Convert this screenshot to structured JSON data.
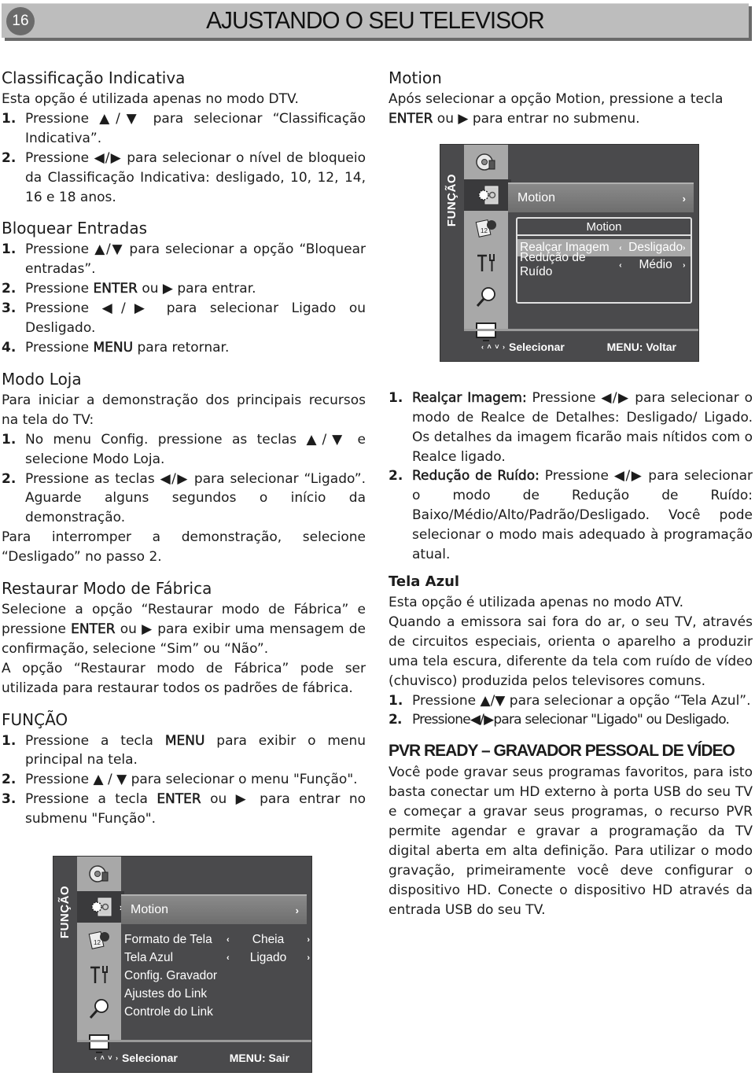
{
  "header": {
    "page_number": "16",
    "title": "AJUSTANDO O SEU TELEVISOR"
  },
  "left": {
    "classificacao": {
      "title": "Classificação Indicativa",
      "intro": "Esta opção é utilizada apenas no modo DTV.",
      "steps": [
        {
          "n": "1.",
          "text": "Pressione ▲/▼ para selecionar “Classificação Indicativa”."
        },
        {
          "n": "2.",
          "text": "Pressione ◀/▶ para selecionar o nível de bloqueio da Classificação Indicativa: desligado, 10, 12, 14, 16 e 18 anos."
        }
      ]
    },
    "bloquear": {
      "title": "Bloquear Entradas",
      "steps": [
        {
          "n": "1.",
          "text": "Pressione ▲/▼ para selecionar a opção “Bloquear entradas”."
        },
        {
          "n": "2.",
          "pre": "Pressione ",
          "bold": "ENTER",
          "post": " ou ▶ para entrar."
        },
        {
          "n": "3.",
          "text": "Pressione ◀/▶ para selecionar Ligado ou Desligado."
        },
        {
          "n": "4.",
          "pre": "Pressione ",
          "bold": "MENU",
          "post": " para retornar."
        }
      ]
    },
    "modo_loja": {
      "title": "Modo Loja",
      "intro": "Para iniciar a demonstração dos principais recursos na tela do TV:",
      "steps": [
        {
          "n": "1.",
          "text": "No menu Config. pressione as teclas ▲/▼ e selecione Modo Loja."
        },
        {
          "n": "2.",
          "text": "Pressione as teclas ◀/▶ para selecionar “Ligado”. Aguarde alguns segundos o início da demonstração."
        }
      ],
      "outro": "Para interromper a demonstração, selecione “Desligado” no passo 2."
    },
    "restaurar": {
      "title": "Restaurar Modo de Fábrica",
      "p1_pre": "Selecione a opção “Restaurar modo de Fábrica” e pressione ",
      "p1_bold": "ENTER",
      "p1_post": " ou ▶ para exibir uma mensagem de confirmação, selecione “Sim” ou “Não”.",
      "p2": "A opção “Restaurar modo de Fábrica” pode ser utilizada para restaurar todos os padrões de fábrica."
    },
    "funcao": {
      "title": "FUNÇÃO",
      "steps": [
        {
          "n": "1.",
          "pre": "Pressione a tecla ",
          "bold": "MENU",
          "post": " para exibir o menu principal na tela."
        },
        {
          "n": "2.",
          "text": "Pressione ▲ / ▼ para selecionar o menu \"Função\"."
        },
        {
          "n": "3.",
          "pre": "Pressione a tecla ",
          "bold": "ENTER",
          "post": " ou ▶ para entrar no submenu \"Função\"."
        }
      ]
    }
  },
  "menu_funcao": {
    "side_label": "FUNÇÃO",
    "selected": "Motion",
    "rows": [
      {
        "label": "Formato de Tela",
        "value": "Cheia",
        "arrows": true
      },
      {
        "label": "Tela Azul",
        "value": "Ligado",
        "arrows": true
      },
      {
        "label": "Config. Gravador",
        "value": "",
        "arrows": false
      },
      {
        "label": "Ajustes do Link",
        "value": "",
        "arrows": false
      },
      {
        "label": "Controle do Link",
        "value": "",
        "arrows": false
      }
    ],
    "footer_select": "Selecionar",
    "footer_menu": "MENU: Sair"
  },
  "right": {
    "motion": {
      "title": "Motion",
      "p_pre": "Após selecionar a opção Motion, pressione a tecla ",
      "p_bold": "ENTER",
      "p_post": " ou ▶ para entrar no submenu."
    },
    "motion_steps": [
      {
        "n": "1.",
        "bold": "Realçar Imagem:",
        "post": " Pressione ◀/▶ para selecionar o modo de Realce de Detalhes: Desligado/ Ligado. Os detalhes da imagem ficarão mais nítidos com o Realce ligado."
      },
      {
        "n": "2.",
        "bold": "Redução de Ruído:",
        "post": " Pressione ◀/▶ para selecionar o modo de Redução de Ruído: Baixo/Médio/Alto/Padrão/Desligado. Você pode selecionar o modo mais adequado à programação atual."
      }
    ],
    "tela_azul": {
      "title": "Tela Azul",
      "p1": "Esta opção é utilizada apenas no modo ATV.",
      "p2": "Quando a emissora sai fora do ar, o seu TV, através de circuitos especiais, orienta o aparelho a produzir uma tela escura, diferente da tela com ruído de vídeo (chuvisco) produzida pelos televisores comuns.",
      "steps": [
        {
          "n": "1.",
          "text": "Pressione ▲/▼ para selecionar a opção “Tela Azul”."
        },
        {
          "n": "2.",
          "text": "Pressione◀/▶para selecionar \"Ligado\" ou Desligado."
        }
      ]
    },
    "pvr": {
      "title": "PVR READY – GRAVADOR PESSOAL DE VÍDEO",
      "p": "Você pode gravar seus programas favoritos, para isto basta conectar um HD externo à porta USB do seu TV e começar a gravar seus programas, o recurso PVR permite agendar e gravar a programação da TV digital aberta em alta definição. Para utilizar o modo gravação, primeiramente você deve configurar o dispositivo HD. Conecte o dispositivo HD através da entrada USB do seu TV."
    }
  },
  "menu_motion": {
    "side_label": "FUNÇÃO",
    "selected": "Motion",
    "submenu_title": "Motion",
    "rows": [
      {
        "label": "Realçar Imagem",
        "value": "Desligado",
        "highlighted": true
      },
      {
        "label": "Redução de Ruído",
        "value": "Médio",
        "highlighted": false
      }
    ],
    "footer_select": "Selecionar",
    "footer_menu": "MENU: Voltar"
  }
}
